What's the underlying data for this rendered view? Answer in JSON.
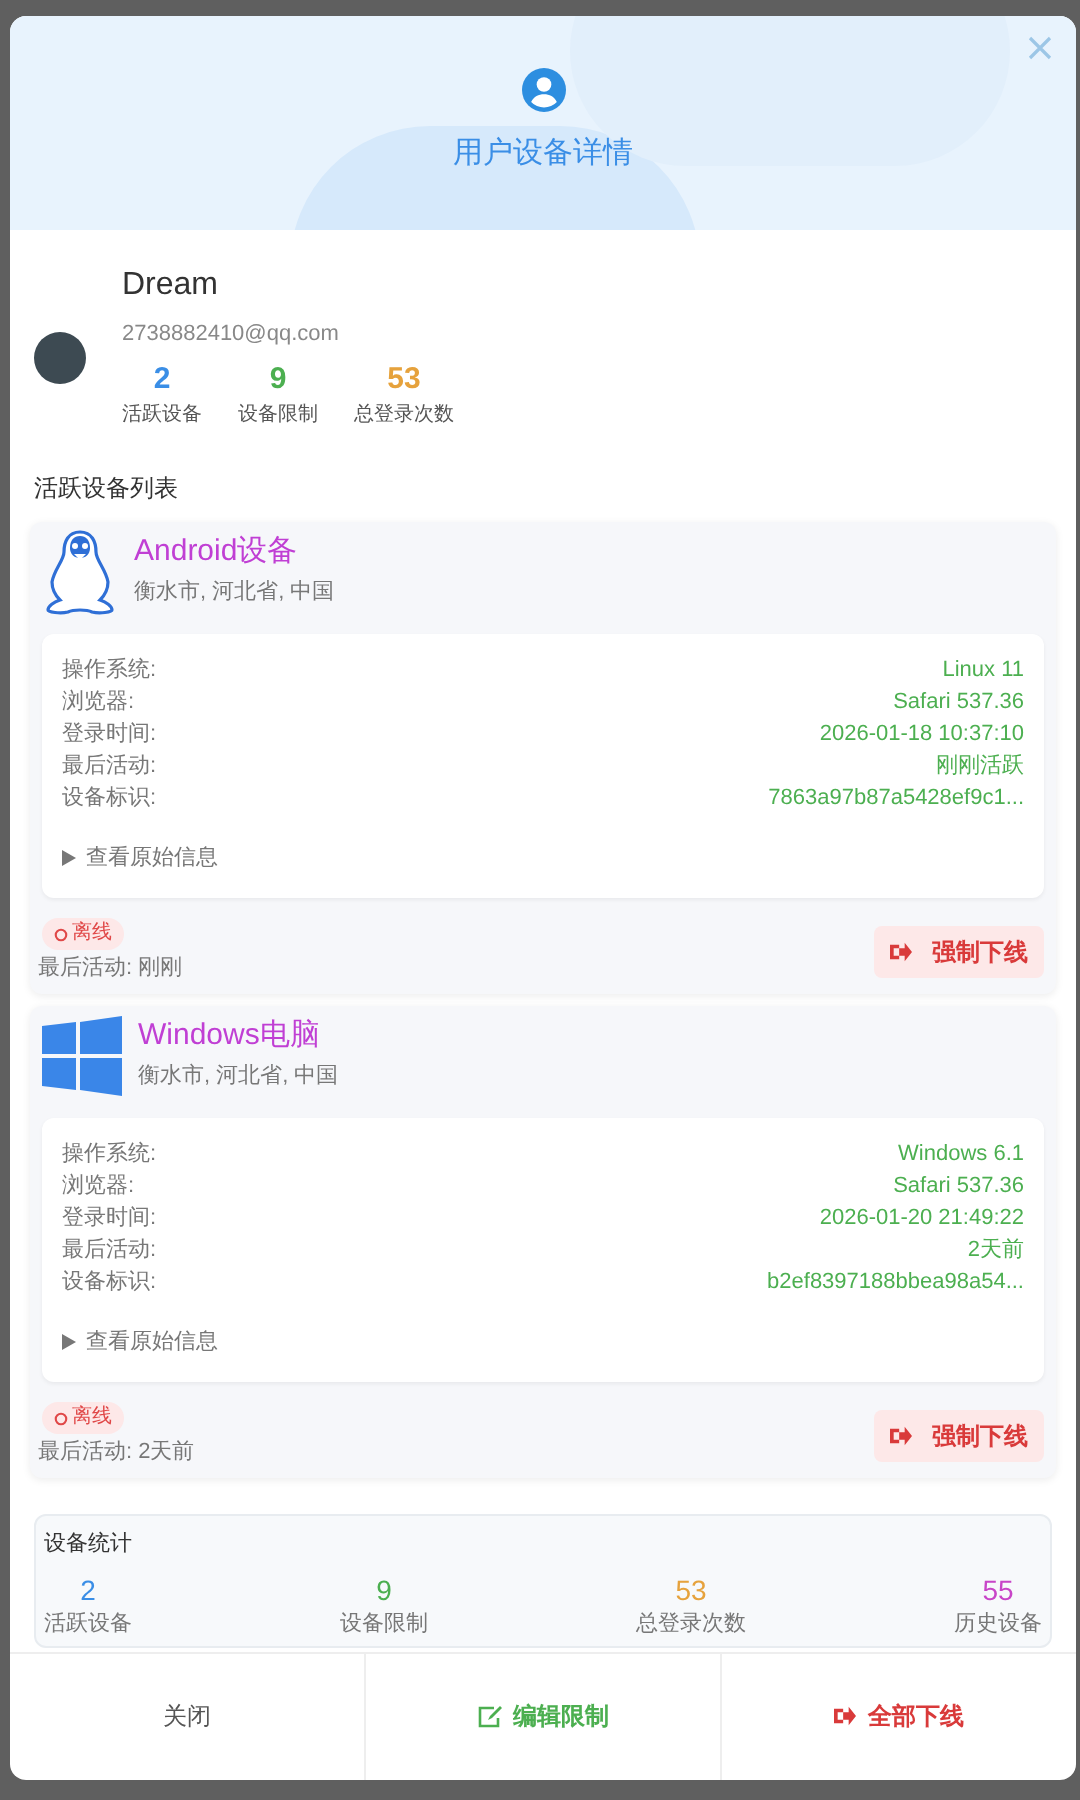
{
  "dialog": {
    "title": "用户设备详情"
  },
  "user": {
    "name": "Dream",
    "email": "2738882410@qq.com",
    "stats": [
      {
        "value": "2",
        "label": "活跃设备",
        "color": "#3a8ee6"
      },
      {
        "value": "9",
        "label": "设备限制",
        "color": "#4caf50"
      },
      {
        "value": "53",
        "label": "总登录次数",
        "color": "#e6a23c"
      }
    ]
  },
  "devices_heading": "活跃设备列表",
  "devices": [
    {
      "kind": "linux",
      "name": "Android设备",
      "location": "衡水市, 河北省, 中国",
      "details": [
        {
          "label": "操作系统:",
          "value": "Linux 11"
        },
        {
          "label": "浏览器:",
          "value": "Safari 537.36"
        },
        {
          "label": "登录时间:",
          "value": "2026-01-18 10:37:10"
        },
        {
          "label": "最后活动:",
          "value": "刚刚活跃"
        },
        {
          "label": "设备标识:",
          "value": "7863a97b87a5428ef9c1..."
        }
      ],
      "raw_toggle": {
        "label": "查看原始信息",
        "expanded": false
      },
      "status": {
        "label": "离线",
        "online": false
      },
      "last_active": "最后活动: 刚刚",
      "action": "强制下线"
    },
    {
      "kind": "windows",
      "name": "Windows电脑",
      "location": "衡水市, 河北省, 中国",
      "details": [
        {
          "label": "操作系统:",
          "value": "Windows 6.1"
        },
        {
          "label": "浏览器:",
          "value": "Safari 537.36"
        },
        {
          "label": "登录时间:",
          "value": "2026-01-20 21:49:22"
        },
        {
          "label": "最后活动:",
          "value": "2天前"
        },
        {
          "label": "设备标识:",
          "value": "b2ef8397188bbea98a54..."
        }
      ],
      "raw_toggle": {
        "label": "查看原始信息",
        "expanded": false
      },
      "status": {
        "label": "离线",
        "online": false
      },
      "last_active": "最后活动: 2天前",
      "action": "强制下线"
    }
  ],
  "summary": {
    "title": "设备统计",
    "stats": [
      {
        "value": "2",
        "label": "活跃设备",
        "color": "#3a8ee6"
      },
      {
        "value": "9",
        "label": "设备限制",
        "color": "#4caf50"
      },
      {
        "value": "53",
        "label": "总登录次数",
        "color": "#e6a23c"
      },
      {
        "value": "55",
        "label": "历史设备",
        "color": "#c845c8"
      }
    ]
  },
  "footer": [
    {
      "kind": "close",
      "label": "关闭"
    },
    {
      "kind": "edit",
      "label": "编辑限制"
    },
    {
      "kind": "logout",
      "label": "全部下线"
    }
  ]
}
